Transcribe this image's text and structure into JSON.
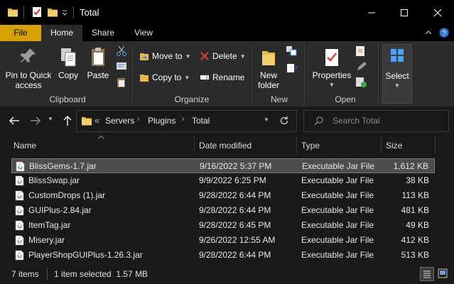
{
  "window": {
    "title": "Total"
  },
  "tabs": {
    "file": "File",
    "home": "Home",
    "share": "Share",
    "view": "View"
  },
  "ribbon": {
    "pin_l1": "Pin to Quick",
    "pin_l2": "access",
    "copy": "Copy",
    "paste": "Paste",
    "clipboard": "Clipboard",
    "move_to": "Move to",
    "copy_to": "Copy to",
    "delete": "Delete",
    "rename": "Rename",
    "organize": "Organize",
    "new_l1": "New",
    "new_l2": "folder",
    "new": "New",
    "properties": "Properties",
    "open": "Open",
    "select": "Select"
  },
  "address": {
    "chevrons": "«",
    "crumbs": [
      "Servers",
      "Plugins",
      "Total"
    ],
    "search_placeholder": "Search Total"
  },
  "columns": {
    "name": "Name",
    "date": "Date modified",
    "type": "Type",
    "size": "Size"
  },
  "files": [
    {
      "name": "BlissGems-1.7.jar",
      "date": "9/16/2022 5:37 PM",
      "type": "Executable Jar File",
      "size": "1,612 KB"
    },
    {
      "name": "BlissSwap.jar",
      "date": "9/9/2022 6:25 PM",
      "type": "Executable Jar File",
      "size": "38 KB"
    },
    {
      "name": "CustomDrops (1).jar",
      "date": "9/28/2022 6:44 PM",
      "type": "Executable Jar File",
      "size": "113 KB"
    },
    {
      "name": "GUIPlus-2.84.jar",
      "date": "9/28/2022 6:44 PM",
      "type": "Executable Jar File",
      "size": "481 KB"
    },
    {
      "name": "ItemTag.jar",
      "date": "9/28/2022 6:45 PM",
      "type": "Executable Jar File",
      "size": "49 KB"
    },
    {
      "name": "Misery.jar",
      "date": "9/26/2022 12:55 AM",
      "type": "Executable Jar File",
      "size": "412 KB"
    },
    {
      "name": "PlayerShopGUIPlus-1.26.3.jar",
      "date": "9/28/2022 6:44 PM",
      "type": "Executable Jar File",
      "size": "513 KB"
    }
  ],
  "status": {
    "items": "7 items",
    "selected": "1 item selected  1.57 MB"
  },
  "colors": {
    "accent": "#d6a100",
    "bg": "#191919",
    "ribbon": "#2b2b2b"
  }
}
